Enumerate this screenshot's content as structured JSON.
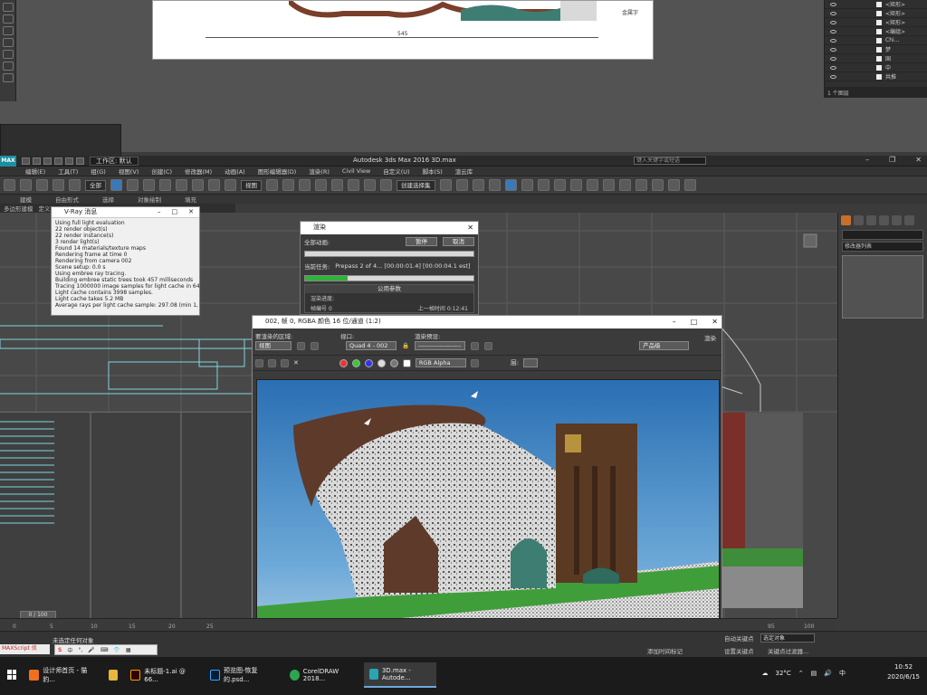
{
  "illustrator": {
    "dimension_label": "545",
    "brand_label": "金属字",
    "layers": [
      {
        "label": "<矩形>"
      },
      {
        "label": "<矩形>"
      },
      {
        "label": "<矩形>"
      },
      {
        "label": "<编组>"
      },
      {
        "label": "Chi..."
      },
      {
        "label": "梦"
      },
      {
        "label": "国"
      },
      {
        "label": "中"
      },
      {
        "label": "共推"
      }
    ],
    "layers_footer": "1 个图层"
  },
  "max": {
    "logo": "MAX",
    "workspace": "工作区: 默认",
    "title": "Autodesk 3ds Max 2016     3D.max",
    "search_placeholder": "键入关键字或短语",
    "menu": [
      "编辑(E)",
      "工具(T)",
      "组(G)",
      "视图(V)",
      "创建(C)",
      "修改器(M)",
      "动画(A)",
      "图形编辑器(D)",
      "渲染(R)",
      "Civil View",
      "自定义(U)",
      "脚本(S)",
      "渲云库"
    ],
    "toolbar": {
      "filter": "全部",
      "view": "视图",
      "selection_set": "创建选择集"
    },
    "ribbon_tabs": [
      "建模",
      "自由形式",
      "选择",
      "对象绘制",
      "填充"
    ],
    "ribbon_sub": [
      "多边形建模",
      "定义边",
      "定义空间"
    ],
    "modifier_list": "修改器列表",
    "timeline": {
      "slider": "0 / 100",
      "ticks": [
        "0",
        "5",
        "10",
        "15",
        "20",
        "25",
        "95",
        "100"
      ]
    },
    "status": {
      "maxscript": "MAXScript 侦",
      "no_selection": "未选定任何对象",
      "add_time_tag": "添加时间标记",
      "auto_key": "自动关键点",
      "set_key": "设置关键点",
      "selected": "选定对象",
      "key_filter": "关键点过滤器..."
    }
  },
  "vray": {
    "title": "V-Ray 消息",
    "lines": [
      "Using full light evaluation",
      "22 render object(s)",
      "22 render instance(s)",
      "3 render light(s)",
      "Found 14 materials/texture maps",
      "Rendering frame at time 0",
      "Rendering from camera 002",
      "Scene setup: 0.0 s",
      "Using embree ray tracing.",
      "Building embree static trees took 457 milliseconds",
      "Tracing 1000000 image samples for light cache in 64 passes",
      "Light cache contains 3998 samples.",
      "Light cache takes 5.2 MB",
      "Average rays per light cache sample: 297.08 (min 1, max 29"
    ]
  },
  "render_progress": {
    "title": "渲染",
    "all_anim": "全部动画:",
    "pause": "暂停",
    "cancel": "取消",
    "current_task_label": "当前任务:",
    "current_task": "Prepass 2 of 4... [00:00:01.4] [00:00:04.1 est]",
    "progress_fraction": 0.25,
    "params_header": "公用参数",
    "render_progress_label": "渲染进度:",
    "frame_label": "帧编号",
    "frame_value": "0",
    "last_frame_label": "上一帧时间",
    "last_frame_value": "0:12:41"
  },
  "frame_buffer": {
    "title": "002, 帧 0, RGBA 颜色 16 位/通道 (1:2)",
    "area_label": "要渲染的区域:",
    "area_value": "视图",
    "viewport_label": "视口:",
    "viewport_value": "Quad 4 - 002",
    "preset_label": "渲染预设:",
    "preset_value": "--------------------",
    "render_label": "渲染",
    "product_value": "产品级",
    "channel": "RGB Alpha",
    "zoom_label": "层:"
  },
  "taskbar": {
    "items": [
      {
        "label": "设计师首页 - 猫豹...",
        "icon_color": "#f07020"
      },
      {
        "label": "",
        "icon_color": "#e5b640"
      },
      {
        "label": "未标题-1.ai @ 66...",
        "icon_color": "#ff9a00"
      },
      {
        "label": "预览图-恢复的.psd...",
        "icon_color": "#31a8ff"
      },
      {
        "label": "CorelDRAW 2018...",
        "icon_color": "#2ea44f"
      },
      {
        "label": "3D.max - Autode...",
        "icon_color": "#2aa3b2"
      }
    ],
    "temperature": "32°C",
    "ime": "中",
    "time": "10:52",
    "date": "2020/6/15"
  },
  "colors": {
    "accent": "#3c78b5",
    "progress_green": "#2fb33a",
    "max_logo": "#1a8fa0"
  }
}
